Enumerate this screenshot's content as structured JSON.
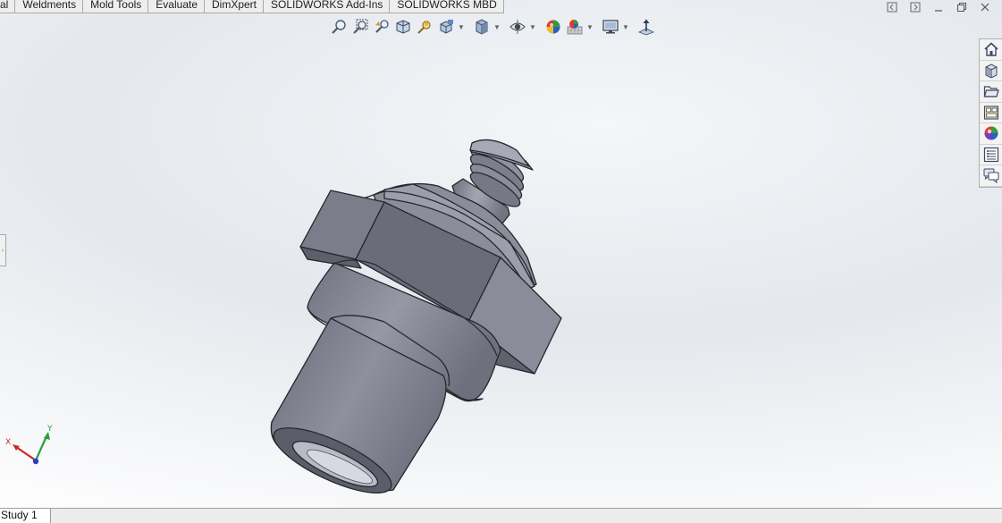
{
  "command_tabs": [
    {
      "label": "al"
    },
    {
      "label": "Weldments"
    },
    {
      "label": "Mold Tools"
    },
    {
      "label": "Evaluate"
    },
    {
      "label": "DimXpert"
    },
    {
      "label": "SOLIDWORKS Add-Ins"
    },
    {
      "label": "SOLIDWORKS MBD"
    }
  ],
  "view_toolbar": {
    "icons": [
      "zoom-to-fit-icon",
      "zoom-to-area-icon",
      "previous-view-icon",
      "section-view-icon",
      "dynamic-annotation-views-icon",
      "view-orientation-icon",
      "display-style-icon",
      "hide-show-items-icon",
      "edit-appearance-icon",
      "apply-scene-icon",
      "view-settings-icon",
      "rotate-view-icon"
    ]
  },
  "task_pane": {
    "icons": [
      "solidworks-resources-icon",
      "design-library-icon",
      "file-explorer-icon",
      "view-palette-icon",
      "appearances-scenes-icon",
      "custom-properties-icon",
      "solidworks-forum-icon"
    ]
  },
  "triad": {
    "x_label": "X",
    "y_label": "Y"
  },
  "bottom_tabs": [
    {
      "label": "Study 1"
    }
  ],
  "colors": {
    "part_light": "#9a9cab",
    "part_mid": "#7d7f8e",
    "part_dark": "#5a5c69",
    "part_edge": "#26272d",
    "axis_x": "#d0282a",
    "axis_y": "#22a03a",
    "axis_z": "#2a3fc4"
  }
}
